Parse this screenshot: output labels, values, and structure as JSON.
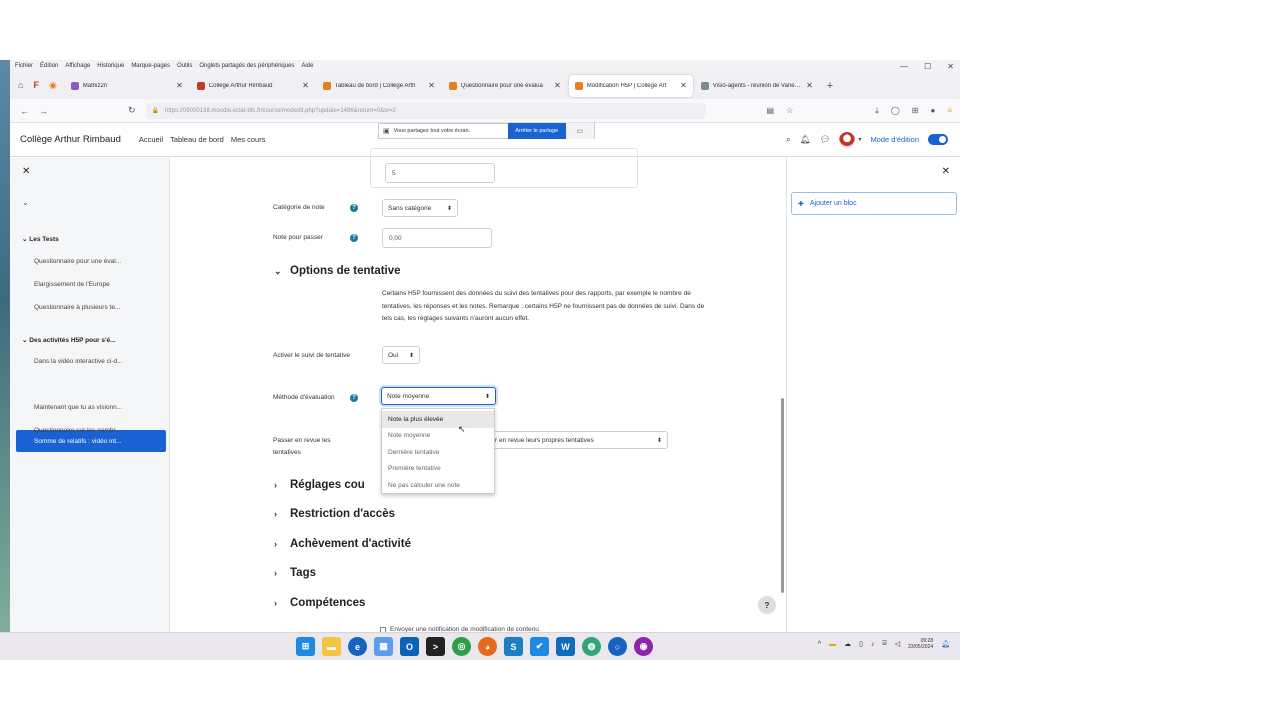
{
  "menubar": [
    "Fichier",
    "Édition",
    "Affichage",
    "Historique",
    "Marque-pages",
    "Outils",
    "Onglets partagés des périphériques",
    "Aide"
  ],
  "tabs": [
    {
      "label": "Mathiz2n",
      "color": "#8a5cc8"
    },
    {
      "label": "Collège Arthur Rimbaud",
      "color": "#c0392b"
    },
    {
      "label": "Tableau de bord | Collège Arth",
      "color": "#e67e22"
    },
    {
      "label": "Questionnaire pour une évalua",
      "color": "#e67e22"
    },
    {
      "label": "Modification H5P | Collège Art",
      "color": "#e67e22"
    },
    {
      "label": "Visio-agents - réunion de Vanessa",
      "color": "#7f8c8d"
    }
  ],
  "url": "https://09000138.moodle.eclat-bfc.fr/course/modedit.php?update=1496&return=0&sr=2",
  "header": {
    "brand": "Collège Arthur Rimbaud",
    "nav": [
      "Accueil",
      "Tableau de bord",
      "Mes cours"
    ],
    "share_text": "Vous partagez tout votre écran.",
    "share_button": "Arrêter le partage",
    "edit_mode_label": "Mode d'édition"
  },
  "left_drawer": {
    "section1": "Les Tests",
    "items1": [
      "Questionnaire pour une éval...",
      "Elargissement de l'Europe",
      "Questionnaire à plusieurs te..."
    ],
    "section2": "Des activités H5P pour s'é...",
    "items2": [
      "Dans la vidéo interactive ci-d...",
      "Somme de relatifs : vidéo int...",
      "Maintenant que tu as visionn...",
      "Questionnaire sur les nombr..."
    ]
  },
  "form": {
    "top_input_value": "5",
    "categorie_label": "Catégorie de note",
    "categorie_value": "Sans catégorie",
    "note_passer_label": "Note pour passer",
    "note_passer_value": "0,00",
    "options_heading": "Options de tentative",
    "options_desc": "Certains H5P fournissent des données du suivi des tentatives pour des rapports, par exemple le nombre de tentatives, les réponses et les notes. Remarque : certains H5P ne fournissent pas de données de suivi. Dans de tels cas, les réglages suivants n'auront aucun effet.",
    "suivi_label": "Activer le suivi de tentative",
    "suivi_value": "Oui",
    "methode_label": "Méthode d'évaluation",
    "methode_value": "Note moyenne",
    "revue_label": "Passer en revue les tentatives",
    "revue_value": "ier en revue leurs propres tentatives",
    "dropdown_options": [
      "Note la plus élevée",
      "Note moyenne",
      "Dernière tentative",
      "Première tentative",
      "Ne pas calculer une note"
    ],
    "sections": [
      "Réglages cou",
      "Restriction d'accès",
      "Achèvement d'activité",
      "Tags",
      "Compétences"
    ],
    "notify_label": "Envoyer une notification de modification de contenu"
  },
  "right_drawer": {
    "add_block": "Ajouter un bloc"
  },
  "taskbar": {
    "time": "09:28",
    "date": "23/05/2024"
  }
}
